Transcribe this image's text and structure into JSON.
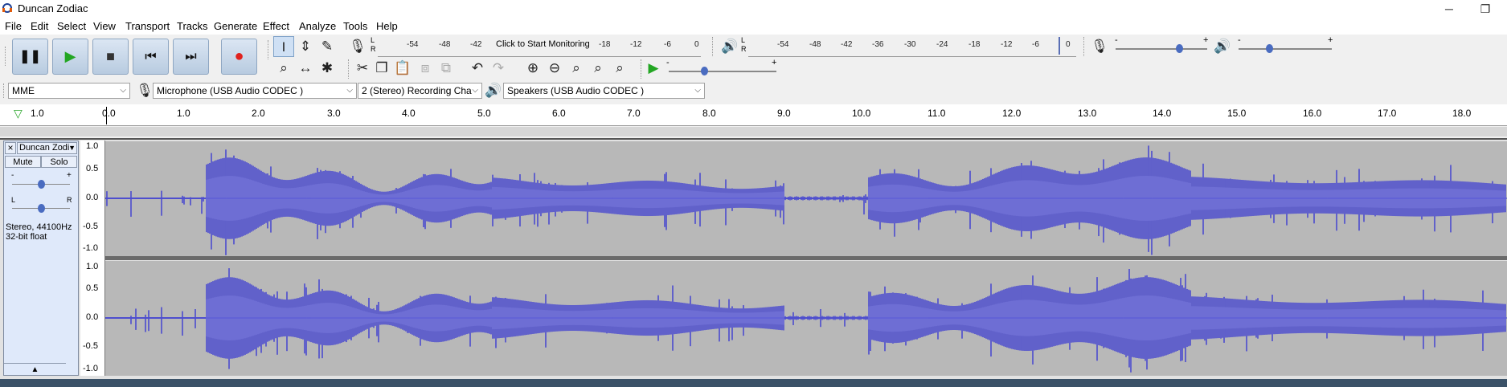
{
  "window": {
    "title": "Duncan Zodiac",
    "minimize": "─",
    "restore": "❐"
  },
  "menu": [
    "File",
    "Edit",
    "Select",
    "View",
    "Transport",
    "Tracks",
    "Generate",
    "Effect",
    "Analyze",
    "Tools",
    "Help"
  ],
  "transport": {
    "icons": [
      "pause-icon",
      "play-icon",
      "stop-icon",
      "skip-start-icon",
      "skip-end-icon",
      "record-icon"
    ],
    "glyphs": [
      "❚❚",
      "▶",
      "■",
      "⏮",
      "⏭",
      "●"
    ]
  },
  "recording_meter": {
    "lr": "L\nR",
    "scale": [
      "-54",
      "-48",
      "-42",
      "-18",
      "-12",
      "-6",
      "0"
    ],
    "monitor_text": "Click to Start Monitoring"
  },
  "playback_meter": {
    "lr": "L\nR",
    "scale": [
      "-54",
      "-48",
      "-42",
      "-36",
      "-30",
      "-24",
      "-18",
      "-12",
      "-6",
      "0"
    ]
  },
  "mixer": {
    "minus": "-",
    "plus": "+"
  },
  "device": {
    "host": "MME",
    "input": "Microphone (USB Audio CODEC )",
    "channels": "2 (Stereo) Recording Cha",
    "output": "Speakers (USB Audio CODEC )"
  },
  "ruler": {
    "labels": [
      "1.0",
      "0.0",
      "1.0",
      "2.0",
      "3.0",
      "4.0",
      "5.0",
      "6.0",
      "7.0",
      "8.0",
      "9.0",
      "10.0",
      "11.0",
      "12.0",
      "13.0",
      "14.0",
      "15.0",
      "16.0",
      "17.0",
      "18.0"
    ]
  },
  "track": {
    "name": "Duncan Zodi",
    "close": "×",
    "mute": "Mute",
    "solo": "Solo",
    "gain_minus": "-",
    "gain_plus": "+",
    "pan_left": "L",
    "pan_right": "R",
    "info_line1": "Stereo, 44100Hz",
    "info_line2": "32-bit float",
    "collapse": "▲",
    "vscale": [
      "1.0",
      "0.5",
      "0.0",
      "-0.5",
      "-1.0"
    ]
  },
  "colors": {
    "waveform": "#3c3cd2",
    "waveform_rms": "#6464dc",
    "track_bg": "#b8b8b8",
    "accent": "#2b5797"
  }
}
